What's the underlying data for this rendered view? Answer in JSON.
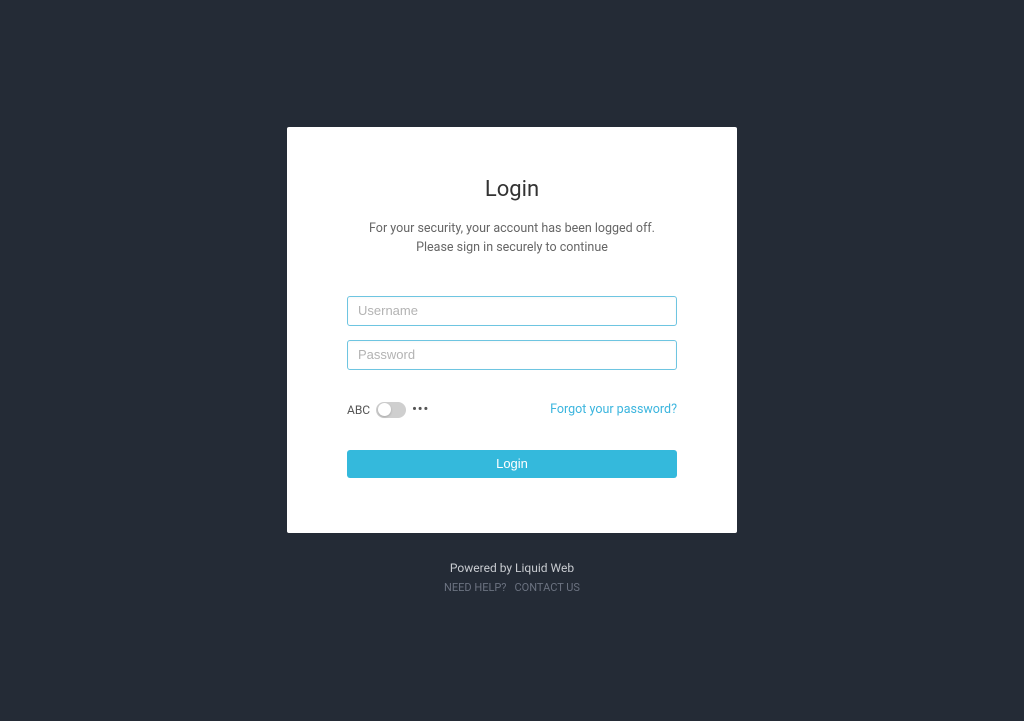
{
  "login": {
    "title": "Login",
    "subtitle_line1": "For your security, your account has been logged off.",
    "subtitle_line2": "Please sign in securely to continue",
    "username_placeholder": "Username",
    "password_placeholder": "Password",
    "abc_label": "ABC",
    "dots": "•••",
    "forgot_password": "Forgot your password?",
    "button_label": "Login"
  },
  "footer": {
    "powered_by": "Powered by Liquid Web",
    "need_help": "NEED HELP?",
    "contact_us": "CONTACT US"
  }
}
